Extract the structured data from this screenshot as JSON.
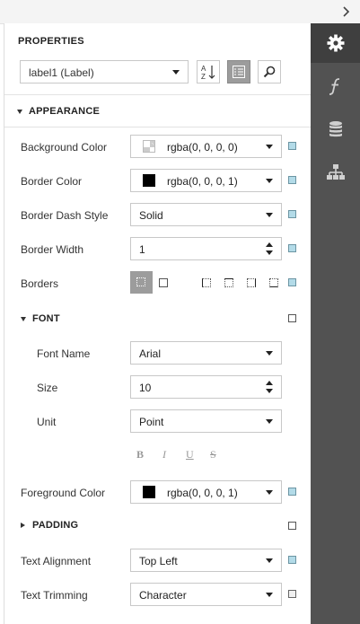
{
  "panel": {
    "title": "PROPERTIES",
    "component_selector": "label1 (Label)"
  },
  "toolbar": {
    "sort_alpha_icon": "sort-alphabetical-icon",
    "categorized_icon": "categorized-view-icon",
    "search_icon": "search-icon"
  },
  "rightbar": {
    "tabs": [
      "gear-icon",
      "function-icon",
      "database-icon",
      "hierarchy-icon"
    ]
  },
  "appearance": {
    "title": "APPEARANCE",
    "background_color": {
      "label": "Background Color",
      "value": "rgba(0, 0, 0, 0)"
    },
    "border_color": {
      "label": "Border Color",
      "value": "rgba(0, 0, 0, 1)"
    },
    "border_dash_style": {
      "label": "Border Dash Style",
      "value": "Solid"
    },
    "border_width": {
      "label": "Border Width",
      "value": "1"
    },
    "borders": {
      "label": "Borders"
    },
    "font": {
      "title": "FONT",
      "font_name": {
        "label": "Font Name",
        "value": "Arial"
      },
      "size": {
        "label": "Size",
        "value": "10"
      },
      "unit": {
        "label": "Unit",
        "value": "Point"
      },
      "styles": [
        "B",
        "I",
        "U",
        "S"
      ]
    },
    "foreground_color": {
      "label": "Foreground Color",
      "value": "rgba(0, 0, 0, 1)"
    },
    "padding": {
      "title": "PADDING"
    },
    "text_alignment": {
      "label": "Text Alignment",
      "value": "Top Left"
    },
    "text_trimming": {
      "label": "Text Trimming",
      "value": "Character"
    }
  },
  "colors": {
    "sidebar": "#525252",
    "sidebar_active": "#3f3f3f",
    "marker_set": "#b3dbe8",
    "toggle_on": "#9c9c9c"
  }
}
